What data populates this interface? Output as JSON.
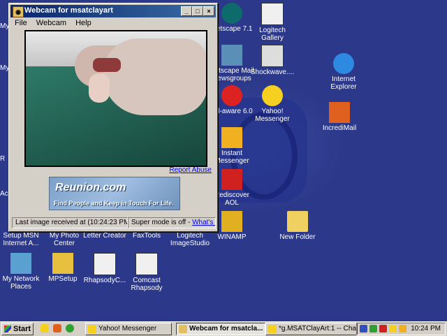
{
  "window": {
    "title": "Webcam for msatclayart",
    "menu": [
      "File",
      "Webcam",
      "Help"
    ],
    "report_abuse": "Report Abuse",
    "ad": {
      "logo": "Reunion.com",
      "tagline": "Find People and Keep In Touch For Life."
    },
    "status": {
      "last_image": "Last image received at (10:24:23 PM)",
      "super_mode": "Super mode is off - ",
      "whats_this": "What's this?"
    }
  },
  "desktop_icons": [
    {
      "label": "Netscape 7.1"
    },
    {
      "label": "Logitech Gallery"
    },
    {
      "label": "Netscape Mail Newsgroups"
    },
    {
      "label": "Shockwave...."
    },
    {
      "label": "Internet Explorer"
    },
    {
      "label": "Ad-aware 6.0"
    },
    {
      "label": "Yahoo! Messenger"
    },
    {
      "label": "IncrediMail"
    },
    {
      "label": "Instant Messenger"
    },
    {
      "label": "Rediscover AOL"
    },
    {
      "label": "WINAMP"
    },
    {
      "label": "New Folder"
    },
    {
      "label": "Setup MSN Internet A..."
    },
    {
      "label": "My Photo Center"
    },
    {
      "label": "Letter Creator"
    },
    {
      "label": "FaxTools"
    },
    {
      "label": "Logitech ImageStudio"
    },
    {
      "label": "My Network Places"
    },
    {
      "label": "MPSetup"
    },
    {
      "label": "RhapsodyC..."
    },
    {
      "label": "Comcast Rhapsody"
    }
  ],
  "edge_labels": [
    "My",
    "My",
    "R",
    "Ac"
  ],
  "taskbar": {
    "start": "Start",
    "tasks": [
      "Yahoo! Messenger",
      "Webcam for msatcla...",
      "*g.MSATClayArt:1 -- Chat"
    ],
    "clock": "10:24 PM"
  }
}
